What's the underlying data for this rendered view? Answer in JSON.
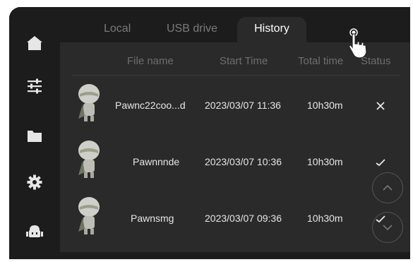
{
  "tabs": [
    {
      "label": "Local"
    },
    {
      "label": "USB drive"
    },
    {
      "label": "History"
    }
  ],
  "table": {
    "columns": [
      "File name",
      "Start Time",
      "Total time",
      "Status"
    ],
    "rows": [
      {
        "file_name": "Pawnc22coo...d",
        "start_time": "2023/03/07 11:36",
        "total_time": "10h30m",
        "status": "failed"
      },
      {
        "file_name": "Pawnnnde",
        "start_time": "2023/03/07 10:36",
        "total_time": "10h30m",
        "status": "completed"
      },
      {
        "file_name": "Pawnsmg",
        "start_time": "2023/03/07 09:36",
        "total_time": "10h30m",
        "status": "completed"
      }
    ]
  },
  "sidebar": {
    "items": [
      {
        "icon": "home-icon"
      },
      {
        "icon": "sliders-icon"
      },
      {
        "icon": "folder-icon"
      },
      {
        "icon": "gear-icon"
      },
      {
        "icon": "robot-icon"
      }
    ]
  },
  "colors": {
    "background": "#1c1c1c",
    "panel": "#2a2a2a",
    "text": "#e6e6e6",
    "muted": "#7a7a7a",
    "active_tab_text": "#ffffff"
  }
}
